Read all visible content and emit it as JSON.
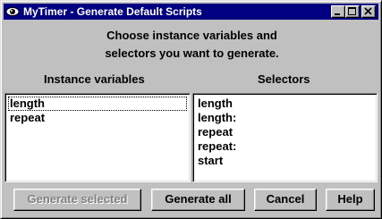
{
  "window": {
    "title": "MyTimer - Generate Default Scripts",
    "icon": "eye-icon",
    "controls": [
      "minimize-icon",
      "maximize-icon",
      "close-icon"
    ]
  },
  "instructions": {
    "line1": "Choose instance variables and",
    "line2": "selectors you want to generate."
  },
  "instance_variables": {
    "label": "Instance variables",
    "items": [
      "length",
      "repeat"
    ],
    "focused_index": 0
  },
  "selectors": {
    "label": "Selectors",
    "items": [
      "length",
      "length:",
      "repeat",
      "repeat:",
      "start"
    ]
  },
  "buttons": {
    "generate_selected": "Generate selected",
    "generate_all": "Generate all",
    "cancel": "Cancel",
    "help": "Help"
  },
  "colors": {
    "titlebar": "#000080",
    "face": "#c0c0c0",
    "disabled_text": "#808080"
  }
}
